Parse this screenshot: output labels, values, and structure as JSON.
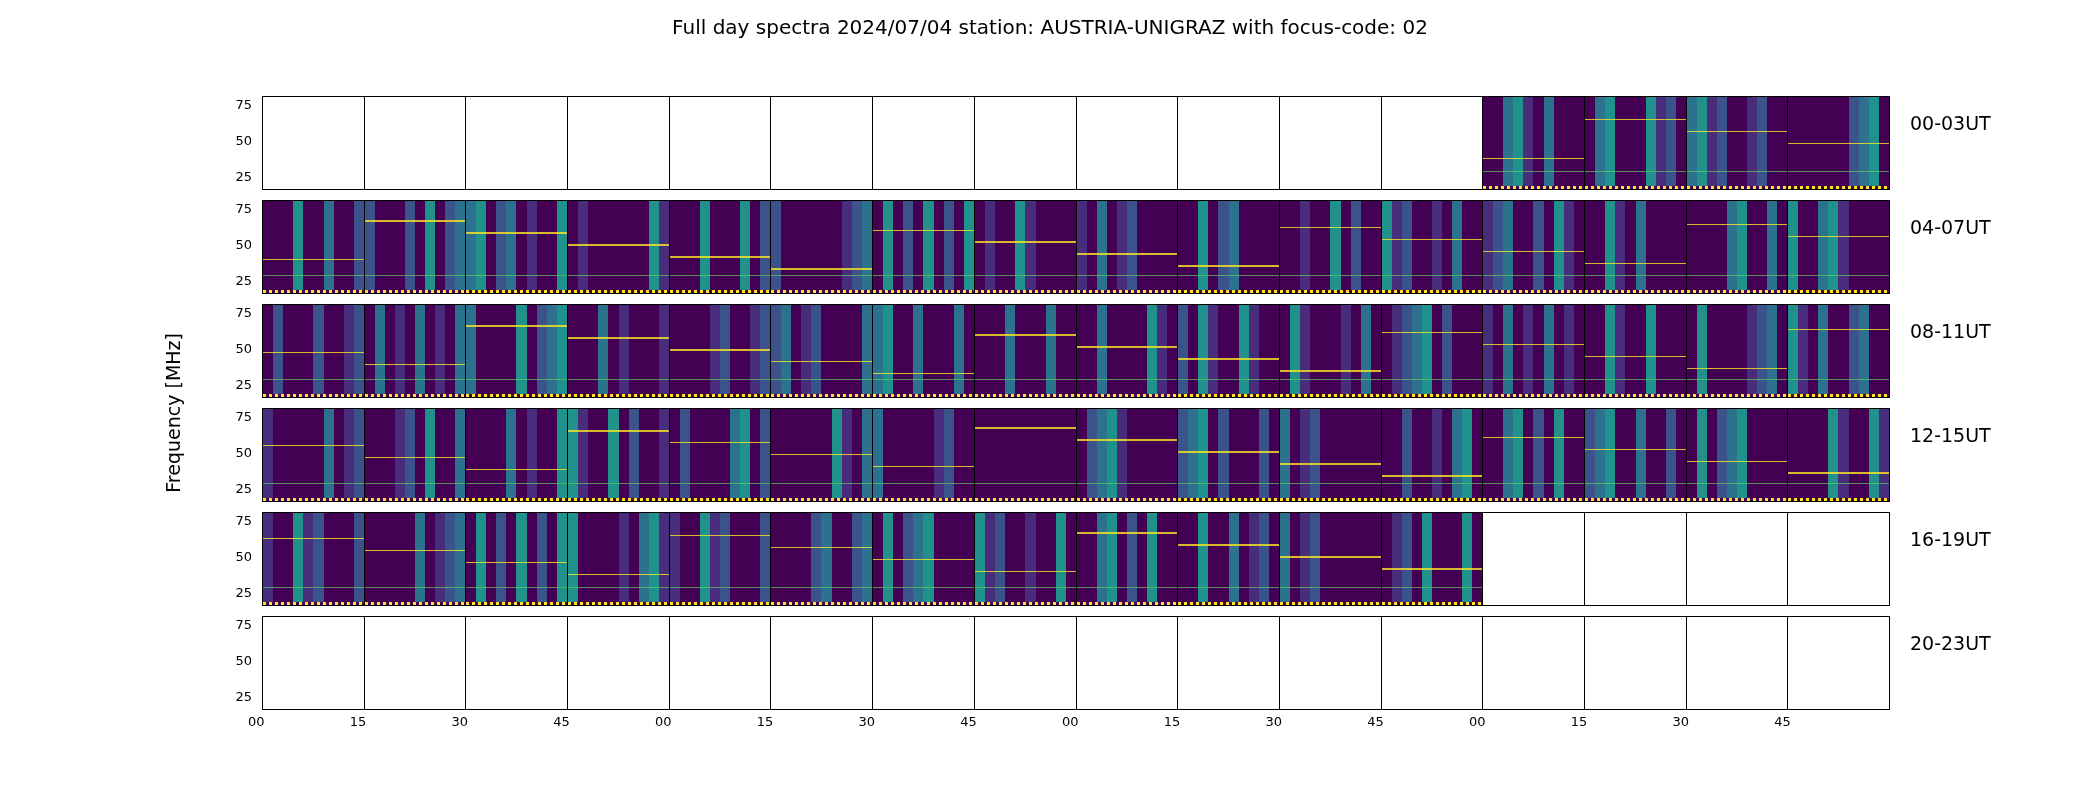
{
  "title": "Full day spectra 2024/07/04 station: AUSTRIA-UNIGRAZ with focus-code: 02",
  "ylabel": "Frequency [MHz]",
  "rows": [
    {
      "label": "00-03UT",
      "yticks": [
        "75",
        "50",
        "25"
      ],
      "panels": [
        {
          "kind": "empty"
        },
        {
          "kind": "empty"
        },
        {
          "kind": "empty"
        },
        {
          "kind": "empty"
        },
        {
          "kind": "empty"
        },
        {
          "kind": "empty"
        },
        {
          "kind": "empty"
        },
        {
          "kind": "empty"
        },
        {
          "kind": "empty"
        },
        {
          "kind": "empty"
        },
        {
          "kind": "empty"
        },
        {
          "kind": "empty"
        },
        {
          "kind": "spectrogram"
        },
        {
          "kind": "spectrogram"
        },
        {
          "kind": "spectrogram"
        },
        {
          "kind": "spectrogram"
        }
      ]
    },
    {
      "label": "04-07UT",
      "yticks": [
        "75",
        "50",
        "25"
      ],
      "panels": [
        {
          "kind": "spectrogram"
        },
        {
          "kind": "spectrogram"
        },
        {
          "kind": "spectrogram"
        },
        {
          "kind": "spectrogram"
        },
        {
          "kind": "spectrogram"
        },
        {
          "kind": "spectrogram"
        },
        {
          "kind": "spectrogram"
        },
        {
          "kind": "spectrogram"
        },
        {
          "kind": "spectrogram"
        },
        {
          "kind": "spectrogram"
        },
        {
          "kind": "spectrogram"
        },
        {
          "kind": "spectrogram"
        },
        {
          "kind": "spectrogram"
        },
        {
          "kind": "spectrogram"
        },
        {
          "kind": "spectrogram"
        },
        {
          "kind": "spectrogram"
        }
      ]
    },
    {
      "label": "08-11UT",
      "yticks": [
        "75",
        "50",
        "25"
      ],
      "panels": [
        {
          "kind": "spectrogram"
        },
        {
          "kind": "spectrogram"
        },
        {
          "kind": "spectrogram"
        },
        {
          "kind": "spectrogram"
        },
        {
          "kind": "spectrogram"
        },
        {
          "kind": "spectrogram"
        },
        {
          "kind": "spectrogram"
        },
        {
          "kind": "spectrogram"
        },
        {
          "kind": "spectrogram"
        },
        {
          "kind": "spectrogram"
        },
        {
          "kind": "spectrogram"
        },
        {
          "kind": "spectrogram"
        },
        {
          "kind": "spectrogram"
        },
        {
          "kind": "spectrogram"
        },
        {
          "kind": "spectrogram"
        },
        {
          "kind": "spectrogram"
        }
      ]
    },
    {
      "label": "12-15UT",
      "yticks": [
        "75",
        "50",
        "25"
      ],
      "panels": [
        {
          "kind": "spectrogram"
        },
        {
          "kind": "spectrogram"
        },
        {
          "kind": "spectrogram"
        },
        {
          "kind": "spectrogram"
        },
        {
          "kind": "spectrogram"
        },
        {
          "kind": "spectrogram"
        },
        {
          "kind": "spectrogram"
        },
        {
          "kind": "spectrogram"
        },
        {
          "kind": "spectrogram"
        },
        {
          "kind": "spectrogram"
        },
        {
          "kind": "spectrogram"
        },
        {
          "kind": "spectrogram"
        },
        {
          "kind": "spectrogram"
        },
        {
          "kind": "spectrogram"
        },
        {
          "kind": "spectrogram"
        },
        {
          "kind": "spectrogram"
        }
      ]
    },
    {
      "label": "16-19UT",
      "yticks": [
        "75",
        "50",
        "25"
      ],
      "panels": [
        {
          "kind": "spectrogram"
        },
        {
          "kind": "spectrogram"
        },
        {
          "kind": "spectrogram"
        },
        {
          "kind": "spectrogram"
        },
        {
          "kind": "spectrogram"
        },
        {
          "kind": "spectrogram"
        },
        {
          "kind": "spectrogram"
        },
        {
          "kind": "spectrogram"
        },
        {
          "kind": "spectrogram"
        },
        {
          "kind": "spectrogram"
        },
        {
          "kind": "spectrogram"
        },
        {
          "kind": "spectrogram"
        },
        {
          "kind": "empty"
        },
        {
          "kind": "empty"
        },
        {
          "kind": "empty"
        },
        {
          "kind": "empty"
        }
      ]
    },
    {
      "label": "20-23UT",
      "yticks": [
        "75",
        "50",
        "25"
      ],
      "panels": [
        {
          "kind": "empty"
        },
        {
          "kind": "empty"
        },
        {
          "kind": "empty"
        },
        {
          "kind": "empty"
        },
        {
          "kind": "empty"
        },
        {
          "kind": "empty"
        },
        {
          "kind": "empty"
        },
        {
          "kind": "empty"
        },
        {
          "kind": "empty"
        },
        {
          "kind": "empty"
        },
        {
          "kind": "empty"
        },
        {
          "kind": "empty"
        },
        {
          "kind": "empty"
        },
        {
          "kind": "empty"
        },
        {
          "kind": "empty"
        },
        {
          "kind": "empty"
        }
      ]
    }
  ],
  "xticks": [
    "00",
    "15",
    "30",
    "45",
    "00",
    "15",
    "30",
    "45",
    "00",
    "15",
    "30",
    "45",
    "00",
    "15",
    "30",
    "45"
  ]
}
